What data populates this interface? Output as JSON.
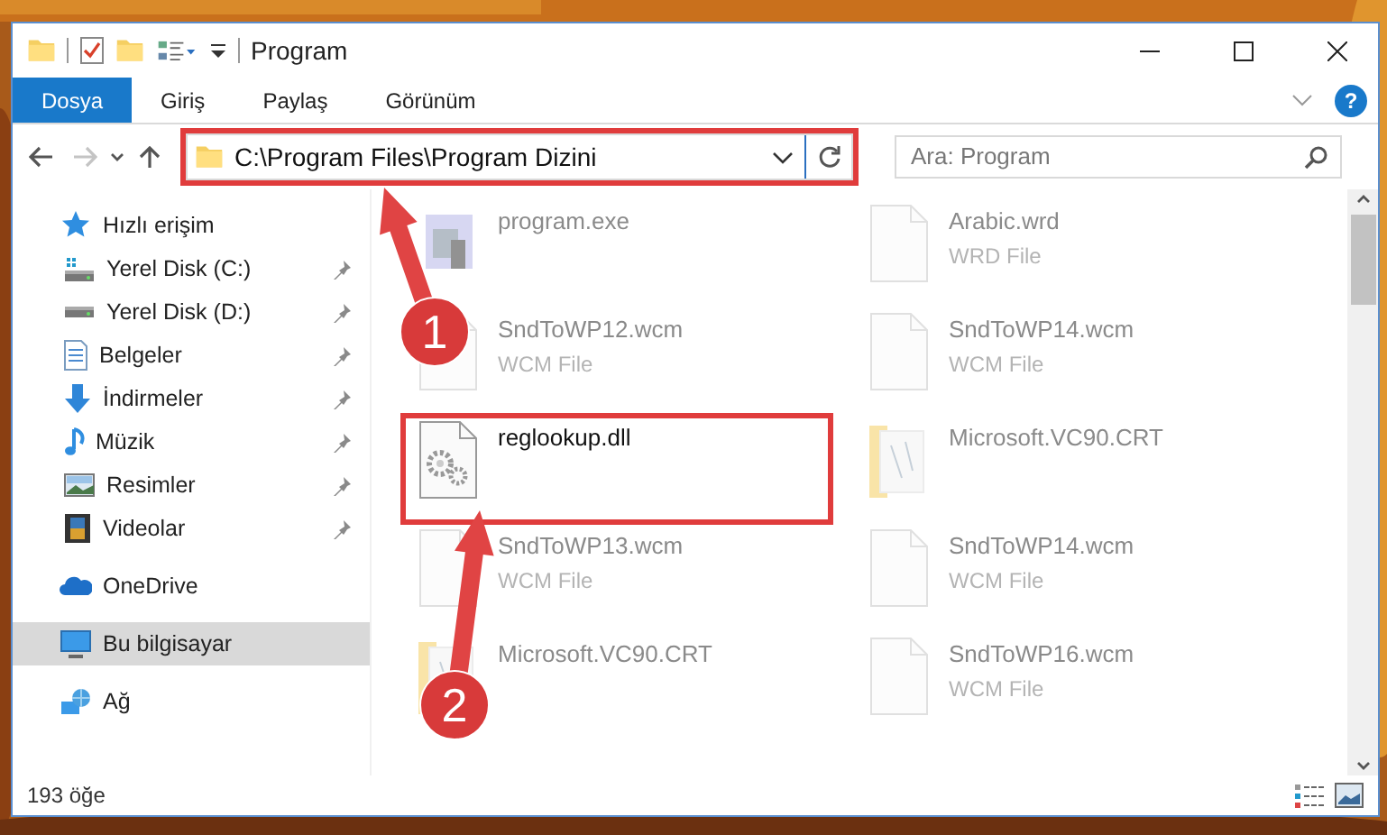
{
  "window": {
    "title": "Program"
  },
  "ribbon": {
    "tabs": [
      {
        "label": "Dosya",
        "kind": "file"
      },
      {
        "label": "Giriş",
        "kind": "tab"
      },
      {
        "label": "Paylaş",
        "kind": "tab"
      },
      {
        "label": "Görünüm",
        "kind": "tab"
      }
    ],
    "help": "?"
  },
  "navigation": {
    "forward_disabled": true
  },
  "address": {
    "path": "C:\\Program Files\\Program Dizini"
  },
  "search": {
    "placeholder": "Ara: Program"
  },
  "sidebar": {
    "items": [
      {
        "label": "Hızlı erişim",
        "kind": "star",
        "selected": false,
        "children": [
          {
            "label": "Yerel Disk (C:)",
            "kind": "systemdrive",
            "pinned": true,
            "selected": false
          },
          {
            "label": "Yerel Disk (D:)",
            "kind": "drive",
            "pinned": true,
            "selected": false
          },
          {
            "label": "Belgeler",
            "kind": "document",
            "pinned": true,
            "selected": false
          },
          {
            "label": "İndirmeler",
            "kind": "download",
            "pinned": true,
            "selected": false
          },
          {
            "label": "Müzik",
            "kind": "music",
            "pinned": true,
            "selected": false
          },
          {
            "label": "Resimler",
            "kind": "pictures",
            "pinned": true,
            "selected": false
          },
          {
            "label": "Videolar",
            "kind": "video",
            "pinned": true,
            "selected": false
          }
        ]
      },
      {
        "label": "OneDrive",
        "kind": "cloud",
        "selected": false
      },
      {
        "label": "Bu bilgisayar",
        "kind": "computer",
        "selected": true
      },
      {
        "label": "Ağ",
        "kind": "network",
        "selected": false
      }
    ]
  },
  "files": [
    {
      "name": "program.exe",
      "kind": "program",
      "faded": true
    },
    {
      "name": "Arabic.wrd",
      "type": "WRD File",
      "kind": "blank",
      "faded": true
    },
    {
      "name": "SndToWP12.wcm",
      "type": "WCM File",
      "kind": "blank",
      "faded": true
    },
    {
      "name": "SndToWP14.wcm",
      "type": "WCM File",
      "kind": "blank",
      "faded": true
    },
    {
      "name": "reglookup.dll",
      "kind": "library",
      "faded": false
    },
    {
      "name": "Microsoft.VC90.CRT",
      "kind": "folder",
      "faded": true
    },
    {
      "name": "SndToWP13.wcm",
      "type": "WCM File",
      "kind": "blank",
      "faded": true
    },
    {
      "name": "SndToWP14.wcm",
      "type": "WCM File",
      "kind": "blank",
      "faded": true
    },
    {
      "name": "Microsoft.VC90.CRT",
      "kind": "folder",
      "faded": true
    },
    {
      "name": "SndToWP16.wcm",
      "type": "WCM File",
      "kind": "blank",
      "faded": true
    }
  ],
  "status_bar": {
    "count": "193 öğe"
  },
  "annotations": [
    {
      "label": "1"
    },
    {
      "label": "2"
    }
  ]
}
